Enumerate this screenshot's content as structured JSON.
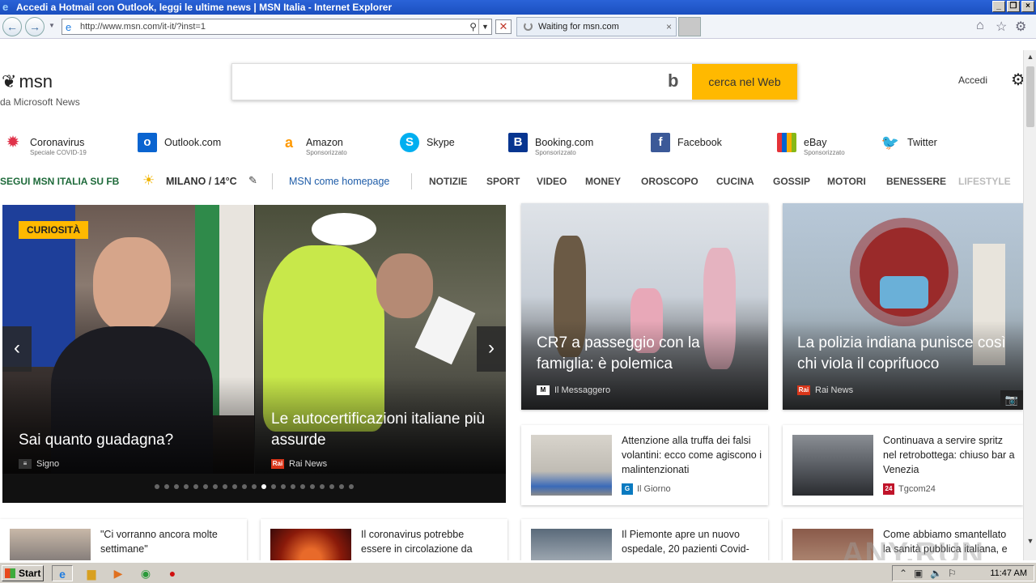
{
  "window": {
    "title": "Accedi a Hotmail con Outlook, leggi le ultime news | MSN Italia - Internet Explorer"
  },
  "browser": {
    "url": "http://www.msn.com/it-it/?inst=1",
    "tab_label": "Waiting for msn.com"
  },
  "header": {
    "logo": "msn",
    "logo_sub": "da Microsoft News",
    "search_placeholder": "",
    "search_button": "cerca nel Web",
    "signin": "Accedi"
  },
  "quicklinks": [
    {
      "label": "Coronavirus",
      "sub": "Speciale COVID-19",
      "icon": "virus-icon",
      "color": "#e0324a"
    },
    {
      "label": "Outlook.com",
      "sub": "",
      "icon": "outlook-icon",
      "color": "#0a64d0"
    },
    {
      "label": "Amazon",
      "sub": "Sponsorizzato",
      "icon": "amazon-icon",
      "color": "#ff9900"
    },
    {
      "label": "Skype",
      "sub": "",
      "icon": "skype-icon",
      "color": "#00aff0"
    },
    {
      "label": "Booking.com",
      "sub": "Sponsorizzato",
      "icon": "booking-icon",
      "color": "#073590"
    },
    {
      "label": "Facebook",
      "sub": "",
      "icon": "facebook-icon",
      "color": "#3b5998"
    },
    {
      "label": "eBay",
      "sub": "Sponsorizzato",
      "icon": "ebay-icon",
      "color": "#e53238"
    },
    {
      "label": "Twitter",
      "sub": "",
      "icon": "twitter-icon",
      "color": "#1da1f2"
    }
  ],
  "nav": {
    "follow": "SEGUI MSN ITALIA SU FB",
    "weather": "MILANO / 14°C",
    "homepage": "MSN come homepage",
    "categories": [
      "NOTIZIE",
      "SPORT",
      "VIDEO",
      "MONEY",
      "OROSCOPO",
      "CUCINA",
      "GOSSIP",
      "MOTORI",
      "BENESSERE",
      "LIFESTYLE"
    ]
  },
  "hero": {
    "badge": "CURIOSITÀ",
    "slides": [
      {
        "title": "Sai quanto guadagna?",
        "source": "Signo"
      },
      {
        "title": "Le autocertificazioni italiane più assurde",
        "source": "Rai News"
      }
    ],
    "dots_total": 21,
    "dot_active": 11
  },
  "featured": [
    {
      "title": "CR7 a passeggio con la famiglia: è polemica",
      "source": "Il Messaggero"
    },
    {
      "title": "La polizia indiana punisce così chi viola il coprifuoco",
      "source": "Rai News"
    }
  ],
  "small_cards": [
    {
      "title": "Attenzione alla truffa dei falsi volantini: ecco come agiscono i malintenzionati",
      "source": "Il Giorno"
    },
    {
      "title": "Continuava a servire spritz nel retrobottega: chiuso bar a Venezia",
      "source": "Tgcom24"
    },
    {
      "title": "\"Ci vorranno ancora molte settimane\"",
      "source": ""
    },
    {
      "title": "Il coronavirus potrebbe essere in circolazione da",
      "source": ""
    },
    {
      "title": "Il Piemonte apre un nuovo ospedale, 20 pazienti Covid-",
      "source": ""
    },
    {
      "title": "Come abbiamo smantellato la sanità pubblica italiana, e",
      "source": ""
    }
  ],
  "taskbar": {
    "start": "Start",
    "clock": "11:47 AM"
  },
  "watermark": "ANY.RUN"
}
